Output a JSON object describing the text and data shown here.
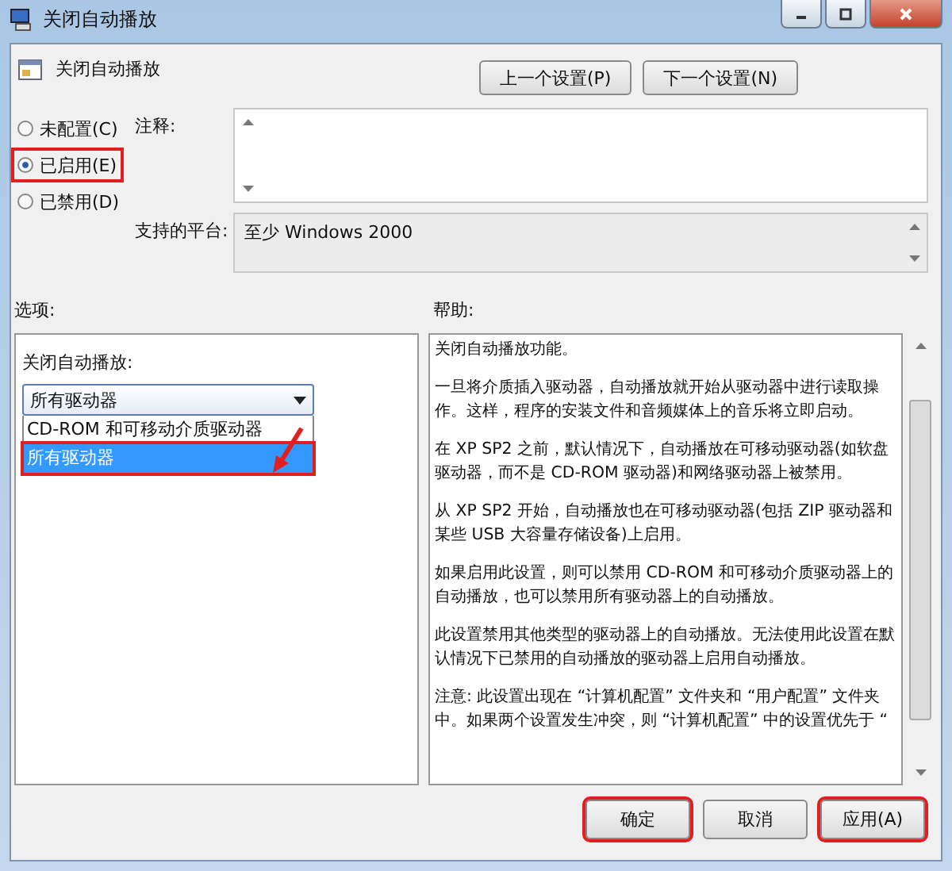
{
  "window": {
    "title": "关闭自动播放"
  },
  "header": {
    "title": "关闭自动播放",
    "buttons": [
      "上一个设置(P)",
      "下一个设置(N)"
    ]
  },
  "states": [
    {
      "label": "未配置(C)",
      "selected": false,
      "annotated": false
    },
    {
      "label": "已启用(E)",
      "selected": true,
      "annotated": true
    },
    {
      "label": "已禁用(D)",
      "selected": false,
      "annotated": false
    }
  ],
  "comment": {
    "label": "注释:"
  },
  "platform": {
    "label": "支持的平台:",
    "value": "至少 Windows 2000"
  },
  "options": {
    "label": "选项:",
    "field_label": "关闭自动播放:",
    "dropdown_value": "所有驱动器",
    "dropdown_items": [
      {
        "label": "CD-ROM 和可移动介质驱动器",
        "selected": false,
        "annotated": false
      },
      {
        "label": "所有驱动器",
        "selected": true,
        "annotated": true
      }
    ]
  },
  "help": {
    "label": "帮助:",
    "paragraphs": [
      "关闭自动播放功能。",
      "一旦将介质插入驱动器，自动播放就开始从驱动器中进行读取操作。这样，程序的安装文件和音频媒体上的音乐将立即启动。",
      "在 XP SP2 之前，默认情况下，自动播放在可移动驱动器(如软盘驱动器，而不是 CD-ROM 驱动器)和网络驱动器上被禁用。",
      "从 XP SP2 开始，自动播放也在可移动驱动器(包括 ZIP 驱动器和某些 USB 大容量存储设备)上启用。",
      "如果启用此设置，则可以禁用 CD-ROM 和可移动介质驱动器上的自动播放，也可以禁用所有驱动器上的自动播放。",
      "此设置禁用其他类型的驱动器上的自动播放。无法使用此设置在默认情况下已禁用的自动播放的驱动器上启用自动播放。",
      "注意: 此设置出现在 “计算机配置” 文件夹和 “用户配置” 文件夹中。如果两个设置发生冲突，则 “计算机配置” 中的设置优先于 “"
    ]
  },
  "footer_buttons": [
    {
      "label": "确定",
      "annotated": true
    },
    {
      "label": "取消",
      "annotated": false
    },
    {
      "label": "应用(A)",
      "annotated": true
    }
  ]
}
